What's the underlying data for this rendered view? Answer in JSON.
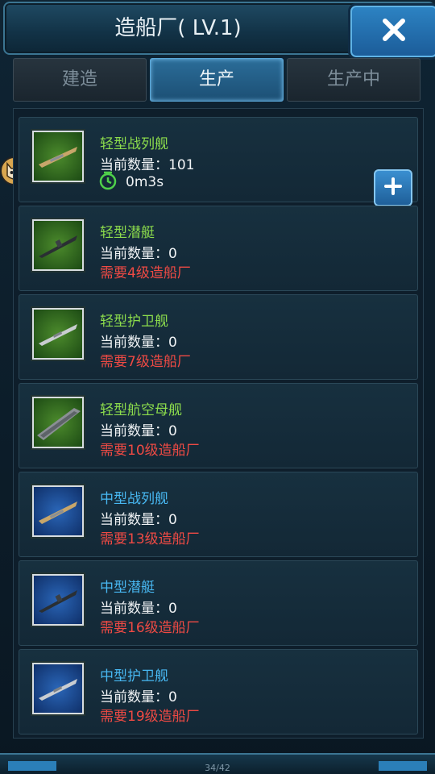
{
  "header": {
    "title": "造船厂( LV.1)"
  },
  "tabs": [
    {
      "label": "建造",
      "active": false
    },
    {
      "label": "生产",
      "active": true
    },
    {
      "label": "生产中",
      "active": false
    }
  ],
  "ships": [
    {
      "name": "轻型战列舰",
      "count": "当前数量：101",
      "timer": "0m3s",
      "color": "green"
    },
    {
      "name": "轻型潜艇",
      "count": "当前数量：0",
      "requirement": "需要4级造船厂",
      "color": "green"
    },
    {
      "name": "轻型护卫舰",
      "count": "当前数量：0",
      "requirement": "需要7级造船厂",
      "color": "green"
    },
    {
      "name": "轻型航空母舰",
      "count": "当前数量：0",
      "requirement": "需要10级造船厂",
      "color": "green"
    },
    {
      "name": "中型战列舰",
      "count": "当前数量：0",
      "requirement": "需要13级造船厂",
      "color": "blue"
    },
    {
      "name": "中型潜艇",
      "count": "当前数量：0",
      "requirement": "需要16级造船厂",
      "color": "blue"
    },
    {
      "name": "中型护卫舰",
      "count": "当前数量：0",
      "requirement": "需要19级造船厂",
      "color": "blue"
    }
  ],
  "icons": {
    "close": "close-icon",
    "plus": "plus-icon",
    "timer": "clock-icon",
    "avatar": "cat-avatar-icon"
  },
  "colors": {
    "green_name": "#8cdc4c",
    "blue_name": "#48b8f2",
    "requirement": "#ef4a44",
    "accent": "#2b6d99"
  },
  "bottom": {
    "page": "34/42"
  }
}
